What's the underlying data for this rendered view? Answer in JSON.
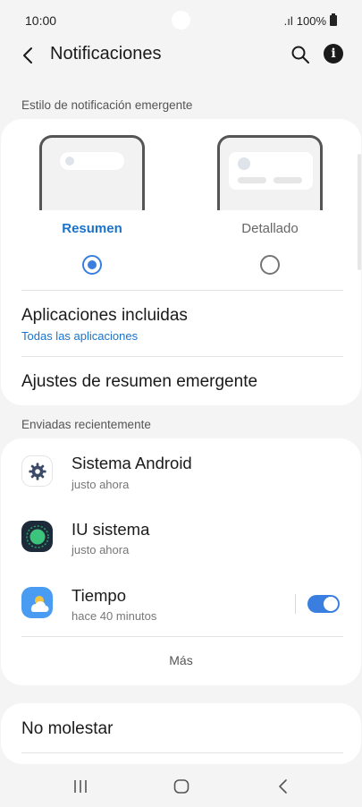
{
  "status": {
    "time": "10:00",
    "signal": ".ıl",
    "battery": "100%"
  },
  "header": {
    "title": "Notificaciones"
  },
  "popup_style": {
    "section_label": "Estilo de notificación emergente",
    "options": [
      {
        "label": "Resumen",
        "selected": true
      },
      {
        "label": "Detallado",
        "selected": false
      }
    ]
  },
  "settings": {
    "included_apps": {
      "title": "Aplicaciones incluidas",
      "value": "Todas las aplicaciones"
    },
    "summary_settings": {
      "title": "Ajustes de resumen emergente"
    }
  },
  "recent": {
    "section_label": "Enviadas recientemente",
    "apps": [
      {
        "name": "Sistema Android",
        "time": "justo ahora",
        "icon": "gear-icon"
      },
      {
        "name": "IU sistema",
        "time": "justo ahora",
        "icon": "system-ui-icon"
      },
      {
        "name": "Tiempo",
        "time": "hace 40 minutos",
        "icon": "weather-icon",
        "enabled": true
      }
    ],
    "more_label": "Más"
  },
  "dnd": {
    "title": "No molestar"
  },
  "colors": {
    "accent": "#3a7fe0",
    "link": "#1a73c9",
    "background": "#f4f4f4"
  }
}
